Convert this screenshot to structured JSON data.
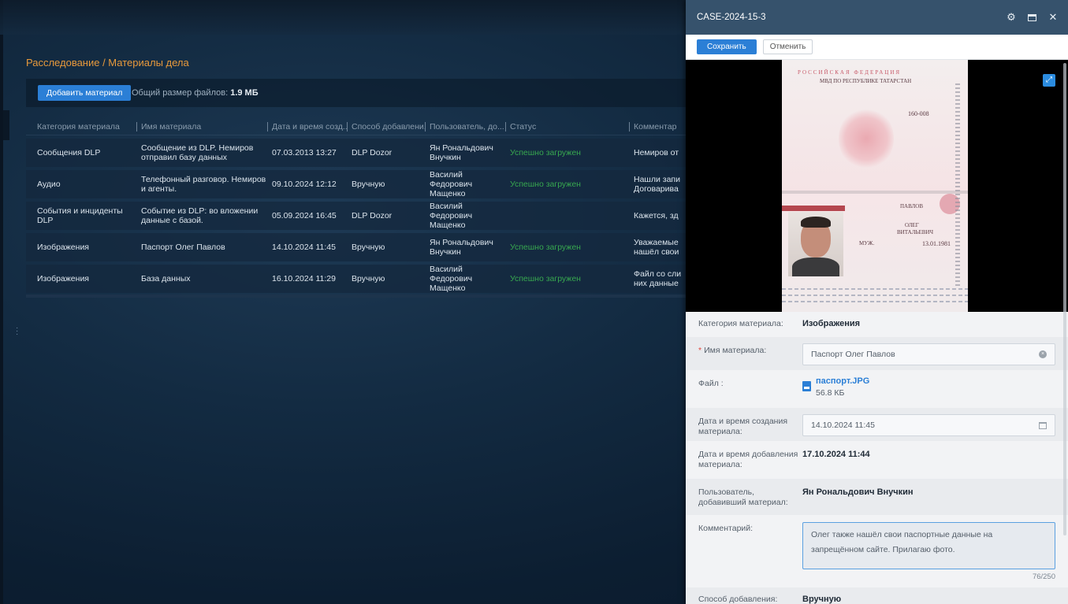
{
  "breadcrumb": "Расследование / Материалы дела",
  "toolbar": {
    "add_label": "Добавить материал",
    "total_size_label": "Общий размер файлов:",
    "total_size_value": "1.9 МБ"
  },
  "table": {
    "columns": [
      "Категория материала",
      "Имя материала",
      "Дата и время созд...",
      "Способ добавлени...",
      "Пользователь, до...",
      "Статус",
      "Комментар"
    ],
    "rows": [
      {
        "category": "Сообщения DLP",
        "name": "Сообщение из DLP. Немиров отправил базу данных",
        "date": "07.03.2013 13:27",
        "method": "DLP Dozor",
        "user": "Ян Рональдович Внучкин",
        "status": "Успешно загружен",
        "comment": "Немиров от"
      },
      {
        "category": "Аудио",
        "name": "Телефонный разговор. Немиров и агенты.",
        "date": "09.10.2024 12:12",
        "method": "Вручную",
        "user": "Василий Федорович Мащенко",
        "status": "Успешно загружен",
        "comment": "Нашли запи Договарива"
      },
      {
        "category": "События и инциденты DLP",
        "name": "Событие из DLP: во вложении данные с базой.",
        "date": "05.09.2024 16:45",
        "method": "DLP Dozor",
        "user": "Василий Федорович Мащенко",
        "status": "",
        "comment": "Кажется, зд"
      },
      {
        "category": "Изображения",
        "name": "Паспорт Олег Павлов",
        "date": "14.10.2024 11:45",
        "method": "Вручную",
        "user": "Ян Рональдович Внучкин",
        "status": "Успешно загружен",
        "comment": "Уважаемые нашёл свои"
      },
      {
        "category": "Изображения",
        "name": "База данных",
        "date": "16.10.2024 11:29",
        "method": "Вручную",
        "user": "Василий Федорович Мащенко",
        "status": "Успешно загружен",
        "comment": "Файл со сли них данные"
      }
    ]
  },
  "panel": {
    "title": "CASE-2024-15-3",
    "save_label": "Сохранить",
    "cancel_label": "Отменить",
    "passport": {
      "issuer_line1": "РОССИЙСКАЯ ФЕДЕРАЦИЯ",
      "issuer_line2": "МВД ПО РЕСПУБЛИКЕ ТАТАРСТАН",
      "code": "160-008",
      "surname": "ПАВЛОВ",
      "given_name": "ОЛЕГ",
      "patronymic": "ВИТАЛЬЕВИЧ",
      "sex": "МУЖ.",
      "birth_date": "13.01.1981"
    },
    "fields": {
      "category_label": "Категория материала:",
      "category_value": "Изображения",
      "name_label": "Имя материала:",
      "name_value": "Паспорт Олег Павлов",
      "file_label": "Файл :",
      "file_name": "паспорт.JPG",
      "file_size": "56.8 КБ",
      "created_label": "Дата и время создания материала:",
      "created_value": "14.10.2024 11:45",
      "added_label": "Дата и время добавления материала:",
      "added_value": "17.10.2024 11:44",
      "user_label": "Пользователь, добавивший материал:",
      "user_value": "Ян Рональдович Внучкин",
      "comment_label": "Комментарий:",
      "comment_value": "Олег также нашёл свои паспортные данные на запрещённом сайте. Прилагаю фото.",
      "comment_counter": "76/250",
      "method_label": "Способ добавления:",
      "method_value": "Вручную"
    }
  },
  "colors": {
    "accent": "#2b7fd6",
    "breadcrumb": "#e89a3c",
    "status_ok": "#37a84f",
    "panel_header": "#36526c"
  }
}
